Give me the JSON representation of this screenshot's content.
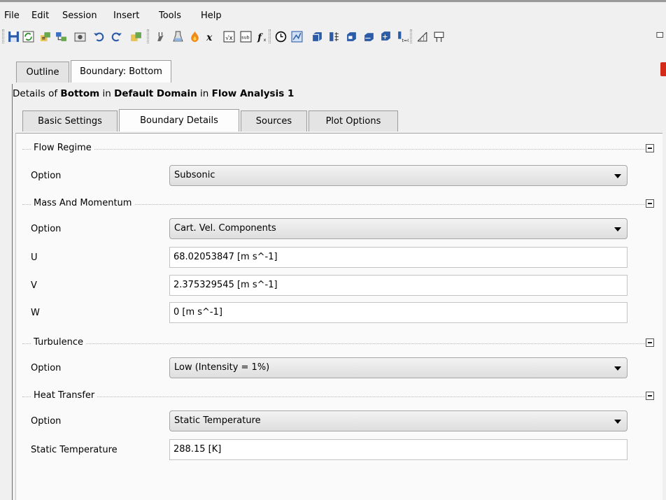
{
  "menu": [
    "File",
    "Edit",
    "Session",
    "Insert",
    "Tools",
    "Help"
  ],
  "toolbar_icons": [
    "save-icon",
    "refresh-icon",
    "import-mesh-icon",
    "mesh-icon",
    "snapshot-icon",
    "undo-icon",
    "redo-icon",
    "import-icon",
    "domain-icon",
    "material-icon",
    "reaction-icon",
    "expression-icon",
    "user-function-icon",
    "user-routine-icon",
    "function-icon",
    "clock-icon",
    "solver-icon",
    "boundary-icon",
    "subdomain-icon",
    "source-point-icon",
    "interface-icon",
    "transient-icon",
    "initialization-icon",
    "mesh-adaption-icon",
    "output-control-icon"
  ],
  "top_tabs": [
    "Outline",
    "Boundary: Bottom"
  ],
  "details": {
    "prefix": "Details of ",
    "object": "Bottom",
    "in1": " in ",
    "domain": "Default Domain",
    "in2": " in ",
    "analysis": "Flow Analysis 1"
  },
  "inner_tabs": [
    "Basic Settings",
    "Boundary Details",
    "Sources",
    "Plot Options"
  ],
  "sections": {
    "flow_regime": {
      "title": "Flow Regime",
      "option_label": "Option",
      "option_value": "Subsonic"
    },
    "mass_momentum": {
      "title": "Mass And Momentum",
      "option_label": "Option",
      "option_value": "Cart. Vel. Components",
      "u_label": "U",
      "u_value": "68.02053847 [m s^-1]",
      "v_label": "V",
      "v_value": "2.375329545 [m s^-1]",
      "w_label": "W",
      "w_value": "0 [m s^-1]"
    },
    "turbulence": {
      "title": "Turbulence",
      "option_label": "Option",
      "option_value": "Low (Intensity = 1%)"
    },
    "heat_transfer": {
      "title": "Heat Transfer",
      "option_label": "Option",
      "option_value": "Static Temperature",
      "temp_label": "Static Temperature",
      "temp_value": "288.15 [K]"
    }
  }
}
